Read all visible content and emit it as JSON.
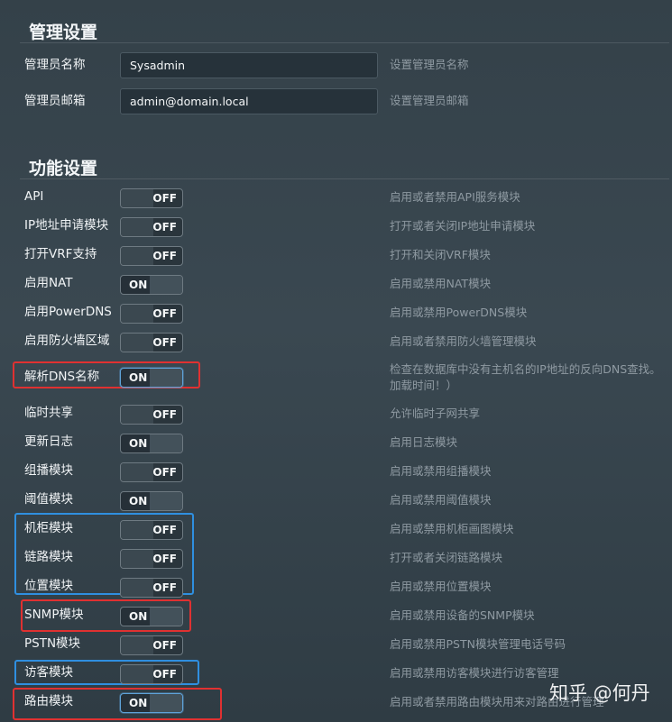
{
  "admin_section": {
    "title": "管理设置",
    "fields": [
      {
        "label": "管理员名称",
        "value": "Sysadmin",
        "hint": "设置管理员名称"
      },
      {
        "label": "管理员邮箱",
        "value": "admin@domain.local",
        "hint": "设置管理员邮箱"
      }
    ]
  },
  "feature_section": {
    "title": "功能设置",
    "rows": [
      {
        "label": "API",
        "state": "OFF",
        "hint": "启用或者禁用API服务模块"
      },
      {
        "label": "IP地址申请模块",
        "state": "OFF",
        "hint": "打开或者关闭IP地址申请模块"
      },
      {
        "label": "打开VRF支持",
        "state": "OFF",
        "hint": "打开和关闭VRF模块"
      },
      {
        "label": "启用NAT",
        "state": "ON",
        "hint": "启用或禁用NAT模块"
      },
      {
        "label": "启用PowerDNS",
        "state": "OFF",
        "hint": "启用或禁用PowerDNS模块"
      },
      {
        "label": "启用防火墙区域",
        "state": "OFF",
        "hint": "启用或者禁用防火墙管理模块"
      },
      {
        "label": "解析DNS名称",
        "state": "ON",
        "hint": "检查在数据库中没有主机名的IP地址的反向DNS查找。",
        "hint2": "加载时间！）"
      },
      {
        "label": "临时共享",
        "state": "OFF",
        "hint": "允许临时子网共享"
      },
      {
        "label": "更新日志",
        "state": "ON",
        "hint": "启用日志模块"
      },
      {
        "label": "组播模块",
        "state": "OFF",
        "hint": "启用或禁用组播模块"
      },
      {
        "label": "阈值模块",
        "state": "ON",
        "hint": "启用或禁用阈值模块"
      },
      {
        "label": "机柜模块",
        "state": "OFF",
        "hint": "启用或禁用机柜画图模块"
      },
      {
        "label": "链路模块",
        "state": "OFF",
        "hint": "打开或者关闭链路模块"
      },
      {
        "label": "位置模块",
        "state": "OFF",
        "hint": "启用或禁用位置模块"
      },
      {
        "label": "SNMP模块",
        "state": "ON",
        "hint": "启用或禁用设备的SNMP模块"
      },
      {
        "label": "PSTN模块",
        "state": "OFF",
        "hint": "启用或禁用PSTN模块管理电话号码"
      },
      {
        "label": "访客模块",
        "state": "OFF",
        "hint": "启用或禁用访客模块进行访客管理"
      },
      {
        "label": "路由模块",
        "state": "ON",
        "hint": "启用或者禁用路由模块用来对路由进行管理"
      }
    ]
  },
  "watermark": "知乎 @何丹",
  "colors": {
    "highlight_red": "#e03131",
    "highlight_blue": "#2f8fe0",
    "toggle_focus": "#5fa3d9"
  }
}
